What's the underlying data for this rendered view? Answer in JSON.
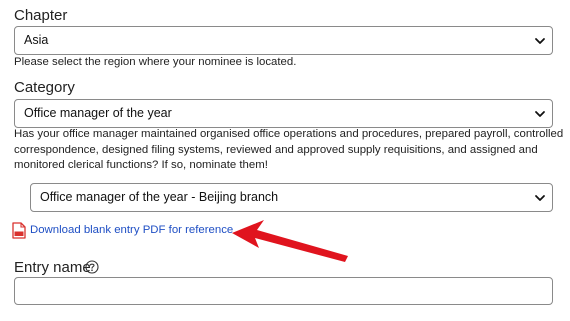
{
  "chapter": {
    "label": "Chapter",
    "selected": "Asia",
    "help": "Please select the region where your nominee is located."
  },
  "category": {
    "label": "Category",
    "selected": "Office manager of the year",
    "description_lines": [
      "Has your office manager maintained organised office operations and procedures, prepared payroll, controlled",
      "correspondence, designed filing systems, reviewed and approved supply requisitions, and assigned and",
      "monitored clerical functions? If so, nominate them!"
    ]
  },
  "subcategory": {
    "selected": "Office manager of the year - Beijing branch"
  },
  "download": {
    "link_text": "Download blank entry PDF for reference",
    "icon": "pdf-file-icon"
  },
  "annotation": {
    "icon": "red-arrow",
    "color": "#e0141e"
  },
  "entry_name": {
    "label": "Entry name",
    "help_icon": "help-circle-icon",
    "value": ""
  },
  "colors": {
    "link": "#1f4fc4",
    "border": "#8a8a8a",
    "arrow": "#e0141e",
    "pdf_icon": "#d9322e"
  }
}
